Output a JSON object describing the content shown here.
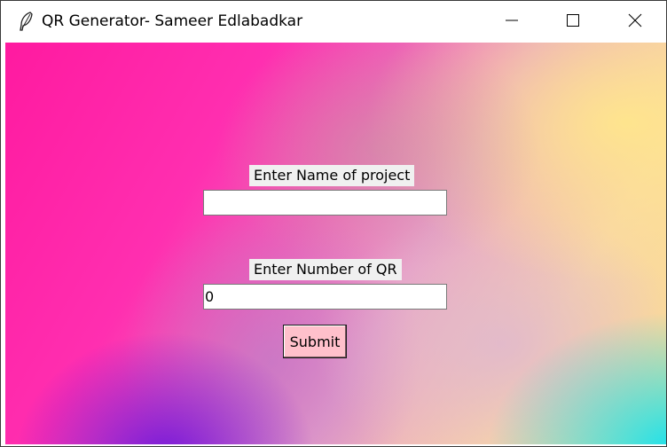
{
  "window": {
    "title": "QR Generator- Sameer Edlabadkar",
    "icon": "feather-icon",
    "controls": [
      "minimize-icon",
      "maximize-icon",
      "close-icon"
    ]
  },
  "form": {
    "name_label": "Enter Name of project",
    "name_value": "",
    "count_label": "Enter Number of QR",
    "count_value": "0",
    "submit_label": "Submit"
  },
  "colors": {
    "submit_bg": "#ffc0cb",
    "label_bg": "#f0f0f0"
  }
}
